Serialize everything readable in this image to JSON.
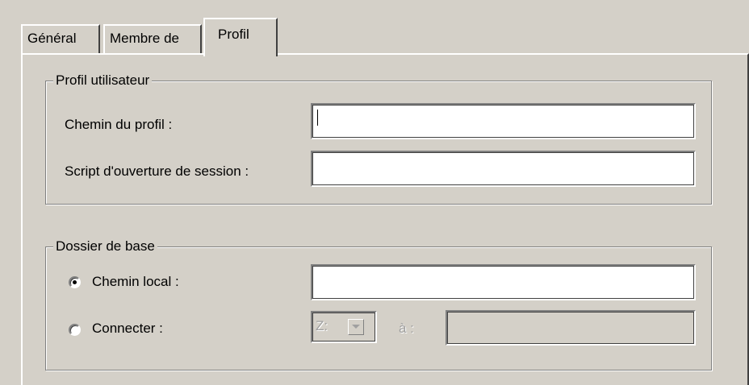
{
  "tabs": [
    {
      "label": "Général",
      "active": false
    },
    {
      "label": "Membre de",
      "active": false
    },
    {
      "label": "Profil",
      "active": true
    }
  ],
  "profile_group": {
    "title": "Profil utilisateur",
    "profile_path_label": "Chemin du profil :",
    "profile_path_value": "",
    "logon_script_label": "Script d'ouverture de session :",
    "logon_script_value": ""
  },
  "home_group": {
    "title": "Dossier de base",
    "local_path_label": "Chemin local :",
    "local_path_selected": true,
    "local_path_value": "",
    "connect_label": "Connecter :",
    "connect_selected": false,
    "drive_value": "Z:",
    "to_label": "à :",
    "to_value": ""
  },
  "icons": {
    "radio_selected": "radio-dot-icon",
    "dropdown_arrow": "chevron-down-icon"
  }
}
